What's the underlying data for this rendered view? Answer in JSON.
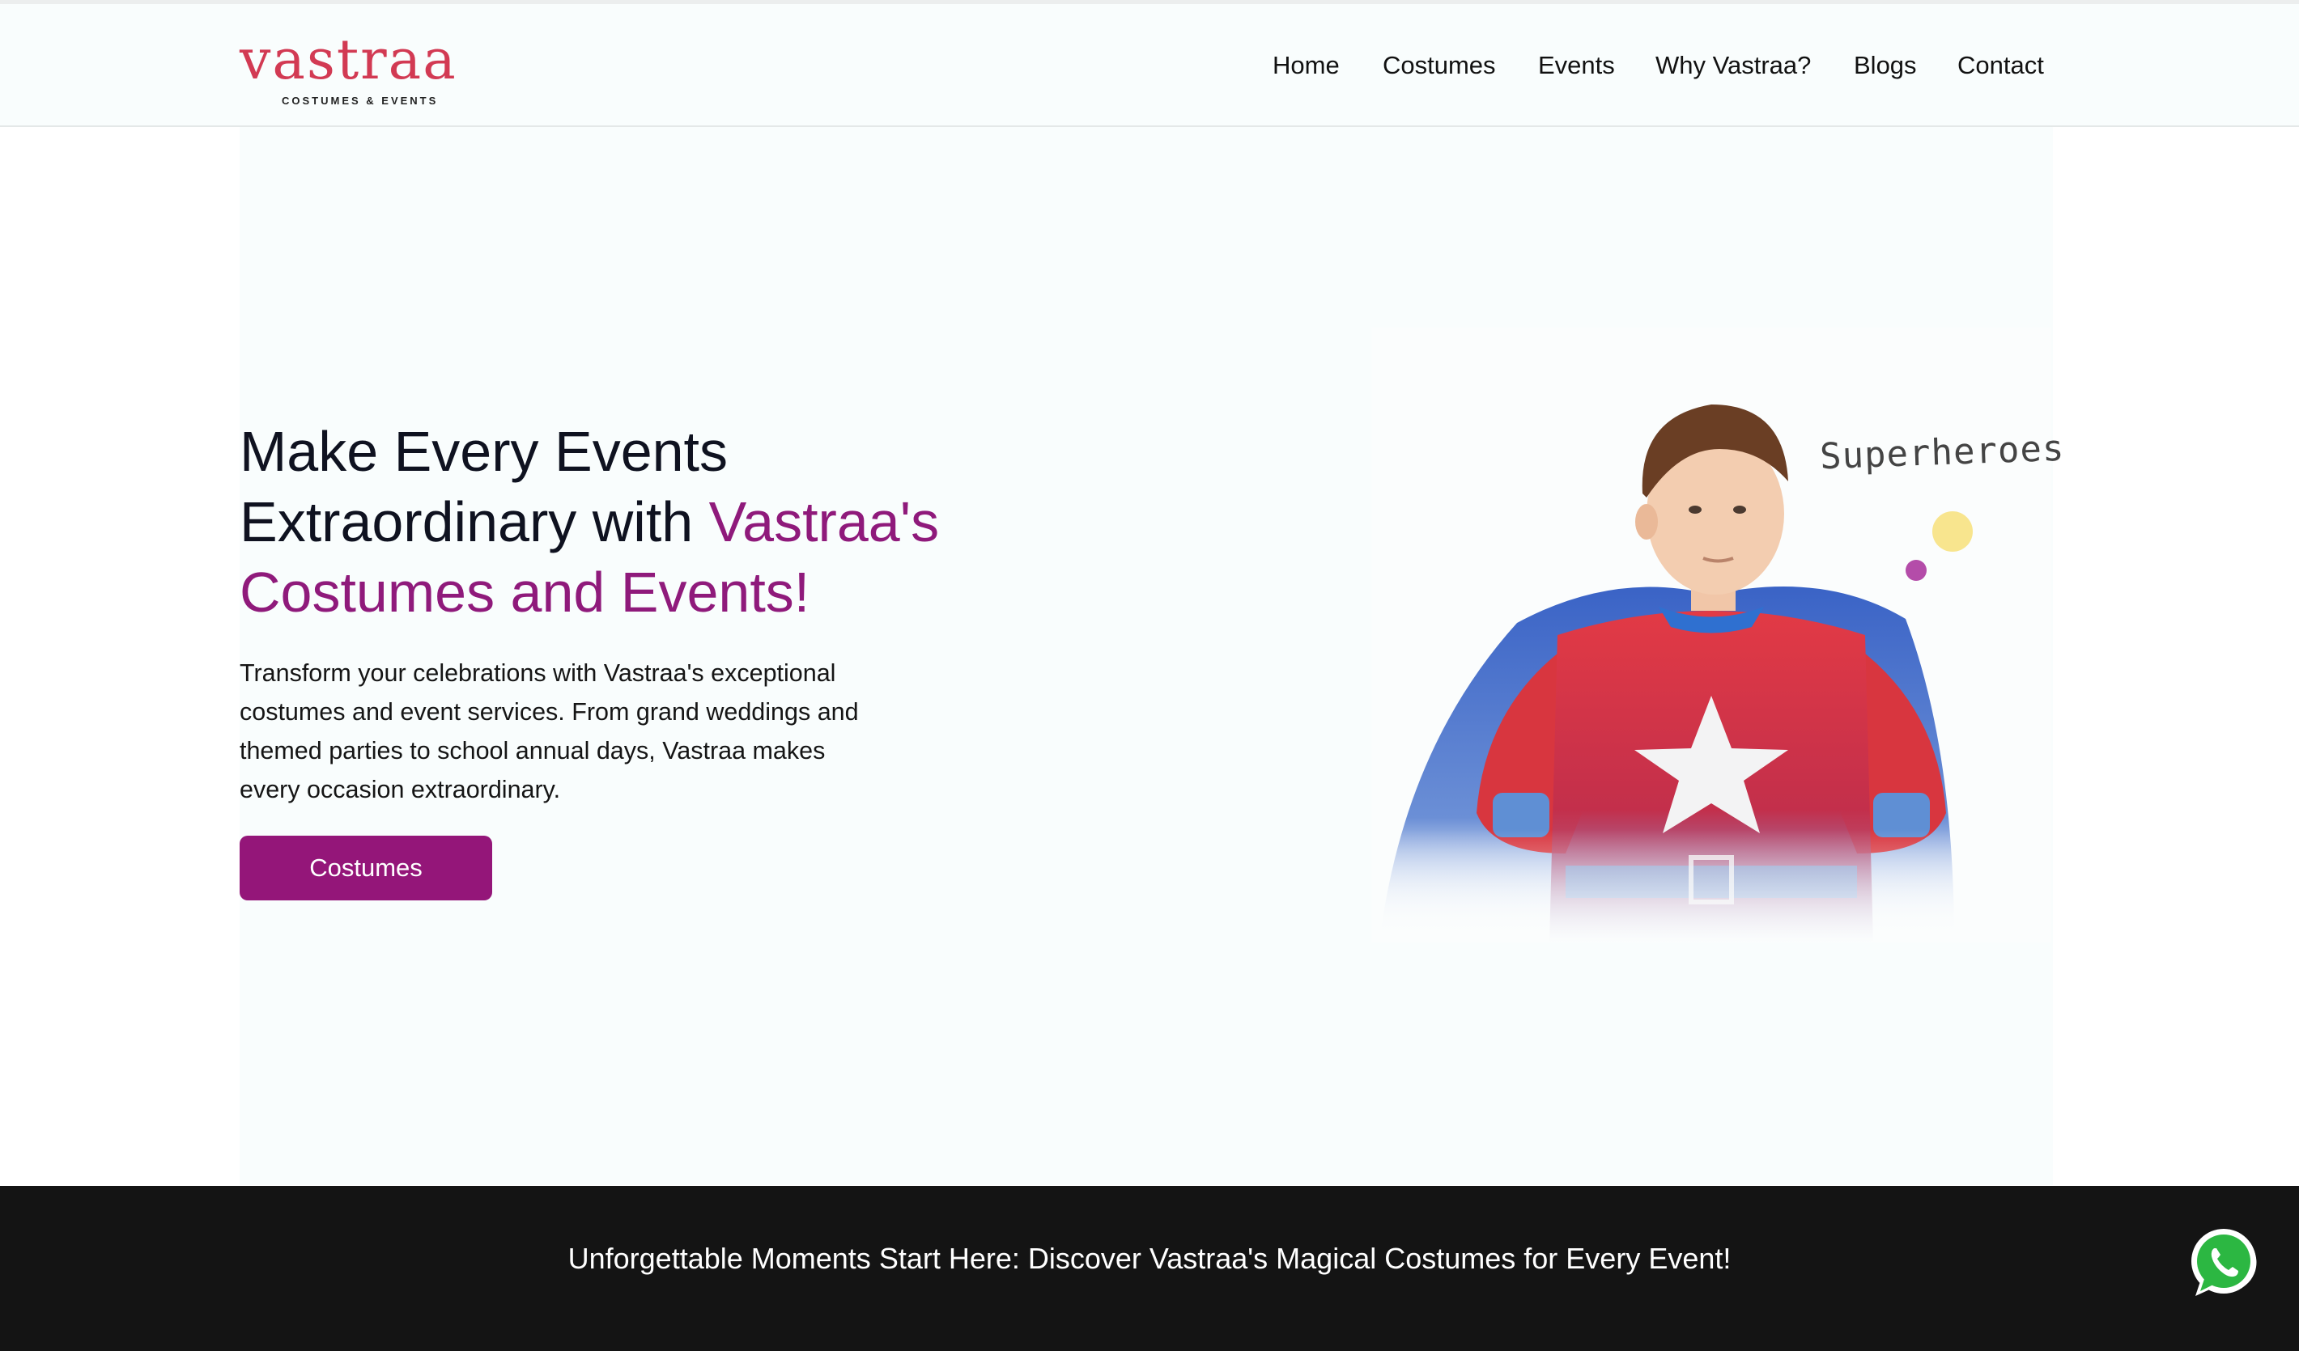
{
  "brand": {
    "logo_text": "vastraa",
    "logo_sub": "COSTUMES & EVENTS",
    "logo_color": "#d23a53"
  },
  "nav": {
    "items": [
      {
        "label": "Home"
      },
      {
        "label": "Costumes"
      },
      {
        "label": "Events"
      },
      {
        "label": "Why Vastraa?"
      },
      {
        "label": "Blogs"
      },
      {
        "label": "Contact"
      }
    ]
  },
  "hero": {
    "headline_line1": "Make Every Events",
    "headline_line2_plain": "Extraordinary with ",
    "headline_line2_accent": "Vastraa's",
    "headline_line3_accent": "Costumes and Events!",
    "paragraph_lines": [
      "Transform your celebrations with Vastraa's exceptional",
      "costumes and event services. From grand weddings and",
      "themed parties to school annual days, Vastraa makes",
      "every occasion extraordinary."
    ],
    "cta_label": "Costumes",
    "image_caption": "Superheroes",
    "accent_color": "#8f1a7b",
    "button_color": "#941679"
  },
  "footer": {
    "text": "Unforgettable Moments Start Here: Discover Vastraa's Magical Costumes for Every Event!"
  },
  "icons": {
    "whatsapp": "whatsapp-icon"
  }
}
